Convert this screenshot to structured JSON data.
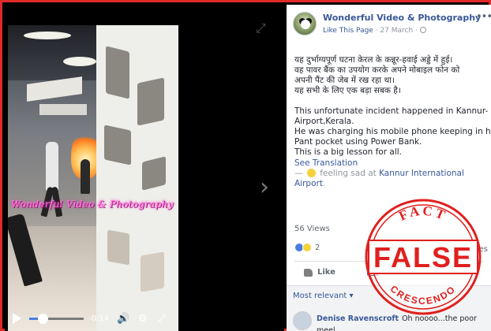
{
  "video": {
    "watermark": "Wonderful Video & Photography",
    "time": "-0:14",
    "progress": 0.22
  },
  "page": {
    "name": "Wonderful Video & Photography",
    "like_label": "Like This Page",
    "separator": " · ",
    "date": "27 March",
    "date_suffix": " ·"
  },
  "post": {
    "hindi_lines": [
      "यह दुर्भाग्यपूर्ण घटना केरल के कन्नूर-हवाई अड्डे में हुई।",
      "वह पावर बैंक का उपयोग करके अपने मोबाइल फोन को",
      "अपनी पैंट की जेब में रख रहा था।",
      "यह सभी के लिए एक बड़ा सबक है।"
    ],
    "english_lines": [
      "This unfortunate incident happened in Kannur-",
      "Airport,Kerala.",
      "He was charging his mobile phone keeping in his",
      "Pant pocket using Power Bank.",
      "This is a big lesson for all."
    ],
    "see_translation": "See Translation",
    "feeling_prefix": "—",
    "feeling": "feeling sad at",
    "place": "Kannur International Airport",
    "feeling_suffix": "."
  },
  "stats": {
    "views": "56 Views",
    "reactions": "2",
    "shares": "shares"
  },
  "actions": {
    "like": "Like"
  },
  "comments": {
    "sort_label": "Most relevant ▾",
    "first": {
      "author": "Denise Ravenscroft",
      "text": "Oh noooo...the poor",
      "text_cont": "meel"
    }
  },
  "stamp": {
    "top_text": "FACT",
    "verdict": "FALSE",
    "bottom_text": "CRESCENDO",
    "color": "#e0201e"
  },
  "colors": {
    "frame": "#e02a2a",
    "link": "#385898",
    "muted": "#90949c"
  }
}
